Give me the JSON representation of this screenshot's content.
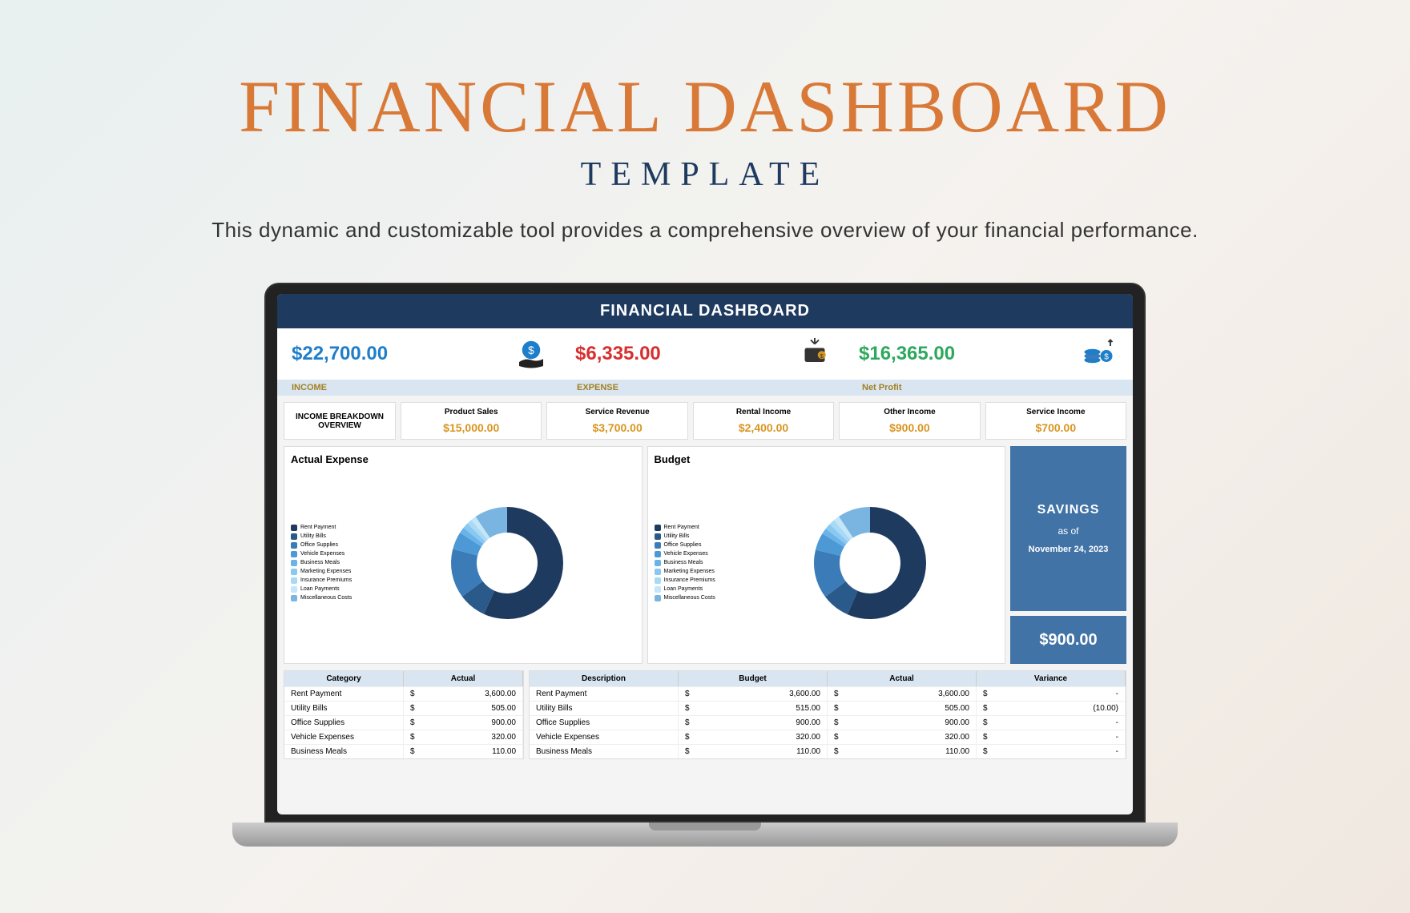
{
  "hero": {
    "title": "FINANCIAL DASHBOARD",
    "subtitle": "TEMPLATE",
    "description": "This dynamic and customizable tool provides a comprehensive overview of your financial performance."
  },
  "dashboard": {
    "header": "FINANCIAL DASHBOARD",
    "top": {
      "income": "$22,700.00",
      "expense": "$6,335.00",
      "netprofit": "$16,365.00",
      "income_label": "INCOME",
      "expense_label": "EXPENSE",
      "netprofit_label": "Net Profit"
    },
    "breakdown": {
      "title": "INCOME BREAKDOWN OVERVIEW",
      "items": [
        {
          "label": "Product Sales",
          "value": "$15,000.00"
        },
        {
          "label": "Service Revenue",
          "value": "$3,700.00"
        },
        {
          "label": "Rental Income",
          "value": "$2,400.00"
        },
        {
          "label": "Other Income",
          "value": "$900.00"
        },
        {
          "label": "Service Income",
          "value": "$700.00"
        }
      ]
    },
    "charts": {
      "actual_title": "Actual Expense",
      "budget_title": "Budget",
      "legend": [
        "Rent Payment",
        "Utility Bills",
        "Office Supplies",
        "Vehicle Expenses",
        "Business Meals",
        "Marketing Expenses",
        "Insurance Premiums",
        "Loan Payments",
        "Miscellaneous Costs"
      ]
    },
    "savings": {
      "title": "SAVINGS",
      "asof": "as of",
      "date": "November 24, 2023",
      "amount": "$900.00"
    },
    "table_left": {
      "headers": [
        "Category",
        "Actual"
      ],
      "rows": [
        [
          "Rent Payment",
          "$",
          "3,600.00"
        ],
        [
          "Utility Bills",
          "$",
          "505.00"
        ],
        [
          "Office Supplies",
          "$",
          "900.00"
        ],
        [
          "Vehicle Expenses",
          "$",
          "320.00"
        ],
        [
          "Business Meals",
          "$",
          "110.00"
        ]
      ]
    },
    "table_right": {
      "headers": [
        "Description",
        "Budget",
        "Actual",
        "Variance"
      ],
      "rows": [
        [
          "Rent Payment",
          "$",
          "3,600.00",
          "$",
          "3,600.00",
          "$",
          "-"
        ],
        [
          "Utility Bills",
          "$",
          "515.00",
          "$",
          "505.00",
          "$",
          "(10.00)"
        ],
        [
          "Office Supplies",
          "$",
          "900.00",
          "$",
          "900.00",
          "$",
          "-"
        ],
        [
          "Vehicle Expenses",
          "$",
          "320.00",
          "$",
          "320.00",
          "$",
          "-"
        ],
        [
          "Business Meals",
          "$",
          "110.00",
          "$",
          "110.00",
          "$",
          "-"
        ]
      ]
    }
  },
  "chart_data": [
    {
      "type": "pie",
      "title": "Actual Expense",
      "categories": [
        "Rent Payment",
        "Utility Bills",
        "Office Supplies",
        "Vehicle Expenses",
        "Business Meals",
        "Marketing Expenses",
        "Insurance Premiums",
        "Loan Payments",
        "Miscellaneous Costs"
      ],
      "values": [
        56.8,
        8.0,
        14.2,
        5.1,
        1.7,
        1.7,
        1.5,
        1.5,
        9.5
      ],
      "labeled_percentages": {
        "Rent Payment": "56.8%",
        "Utility Bills": "8.0%",
        "Office Supplies": "14.2%",
        "Vehicle Expenses": "5.1%",
        "Miscellaneous Costs": "9.5%"
      }
    },
    {
      "type": "pie",
      "title": "Budget",
      "categories": [
        "Rent Payment",
        "Utility Bills",
        "Office Supplies",
        "Vehicle Expenses",
        "Business Meals",
        "Marketing Expenses",
        "Insurance Premiums",
        "Loan Payments",
        "Miscellaneous Costs"
      ],
      "values": [
        56.6,
        8.1,
        14.1,
        5.0,
        1.7,
        1.7,
        1.7,
        1.7,
        9.4
      ],
      "labeled_percentages": {
        "Rent Payment": "56.6%",
        "Utility Bills": "8.1%",
        "Office Supplies": "14.1%",
        "Vehicle Expenses": "5.0%",
        "Miscellaneous Costs": "9.4%"
      }
    }
  ],
  "colors": [
    "#1e3a5f",
    "#2a5a8a",
    "#3b7bb8",
    "#4d99d6",
    "#6ab3e8",
    "#89c8f0",
    "#a8daf5",
    "#c4e6f8",
    "#79b5e0"
  ]
}
